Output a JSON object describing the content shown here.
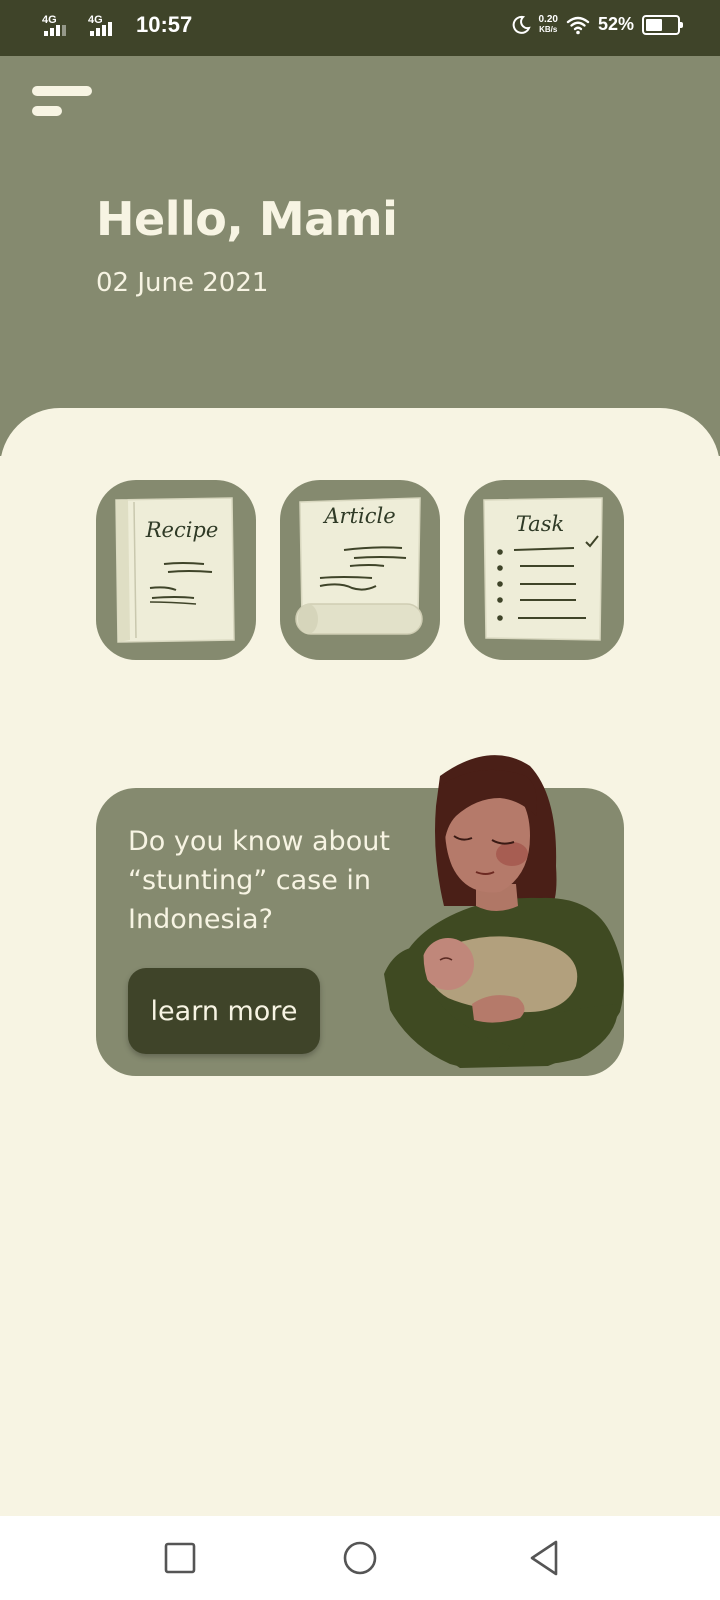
{
  "status_bar": {
    "network_1": "4G",
    "network_2": "4G",
    "time": "10:57",
    "speed_value": "0.20",
    "speed_unit": "KB/s",
    "battery_percent": "52%",
    "battery_level": 0.52,
    "icons": [
      "signal-icon",
      "moon-icon",
      "wifi-icon",
      "battery-icon"
    ]
  },
  "header": {
    "menu_icon": "hamburger-menu-icon",
    "greeting": "Hello, Mami",
    "date": "02 June 2021"
  },
  "tiles": [
    {
      "label": "Recipe",
      "icon": "recipe-book-icon"
    },
    {
      "label": "Article",
      "icon": "article-scroll-icon"
    },
    {
      "label": "Task",
      "icon": "task-checklist-icon"
    }
  ],
  "promo_card": {
    "text": "Do you know about “stunting” case in Indonesia?",
    "button_label": "learn more",
    "illustration": "mother-holding-baby-illustration"
  },
  "nav_bar": {
    "icons": [
      "recent-apps-icon",
      "home-icon",
      "back-icon"
    ]
  },
  "colors": {
    "primary": "#858a6f",
    "dark": "#3f4429",
    "background": "#f7f4e3"
  }
}
